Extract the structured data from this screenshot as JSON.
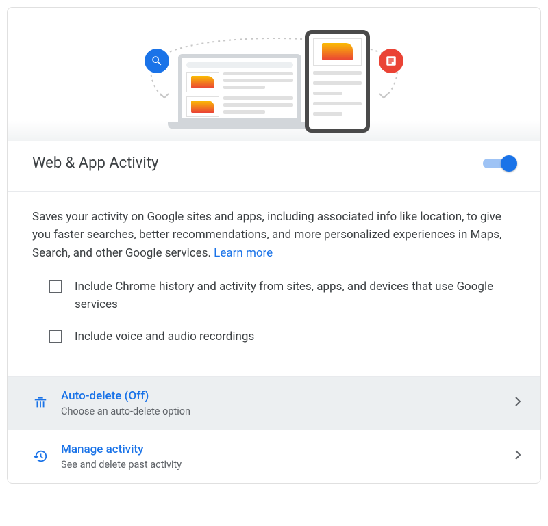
{
  "header": {
    "title": "Web & App Activity",
    "toggle_on": true
  },
  "description": {
    "text": "Saves your activity on Google sites and apps, including associated info like location, to give you faster searches, better recommendations, and more personalized experiences in Maps, Search, and other Google services. ",
    "learn_more": "Learn more"
  },
  "options": [
    {
      "label": "Include Chrome history and activity from sites, apps, and devices that use Google services",
      "checked": false
    },
    {
      "label": "Include voice and audio recordings",
      "checked": false
    }
  ],
  "rows": {
    "auto_delete": {
      "title": "Auto-delete (Off)",
      "subtitle": "Choose an auto-delete option"
    },
    "manage": {
      "title": "Manage activity",
      "subtitle": "See and delete past activity"
    }
  }
}
